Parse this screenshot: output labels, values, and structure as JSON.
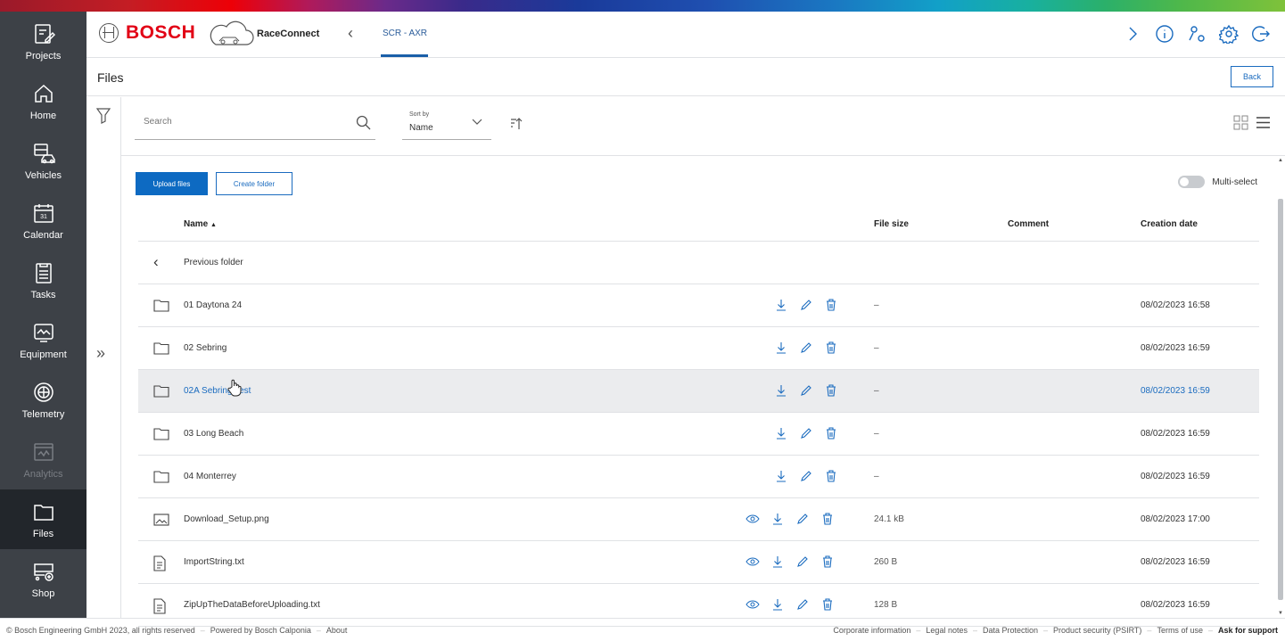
{
  "sidebar": {
    "items": [
      {
        "label": "Projects",
        "icon": "projects-icon"
      },
      {
        "label": "Home",
        "icon": "home-icon"
      },
      {
        "label": "Vehicles",
        "icon": "vehicles-icon"
      },
      {
        "label": "Calendar",
        "icon": "calendar-icon",
        "icon_text": "31"
      },
      {
        "label": "Tasks",
        "icon": "tasks-icon"
      },
      {
        "label": "Equipment",
        "icon": "equipment-icon"
      },
      {
        "label": "Telemetry",
        "icon": "telemetry-icon"
      },
      {
        "label": "Analytics",
        "icon": "analytics-icon",
        "disabled": true
      },
      {
        "label": "Files",
        "icon": "folder-icon",
        "active": true
      },
      {
        "label": "Shop",
        "icon": "shop-icon"
      }
    ]
  },
  "header": {
    "brand": "BOSCH",
    "app_name": "RaceConnect",
    "tab": "SCR - AXR",
    "icons": [
      "chevron-right-icon",
      "info-icon",
      "user-settings-icon",
      "gear-icon",
      "logout-icon"
    ]
  },
  "subheader": {
    "title": "Files",
    "back_label": "Back"
  },
  "toolbar": {
    "search_placeholder": "Search",
    "sort_label": "Sort by",
    "sort_value": "Name"
  },
  "actions": {
    "upload_label": "Upload files",
    "create_folder_label": "Create folder",
    "multiselect_label": "Multi-select",
    "multiselect_on": false
  },
  "table": {
    "headers": {
      "name": "Name",
      "size": "File size",
      "comment": "Comment",
      "date": "Creation date"
    },
    "sort_indicator": "▲",
    "previous_folder": "Previous folder",
    "rows": [
      {
        "type": "folder",
        "name": "01 Daytona 24",
        "size": "–",
        "comment": "",
        "date": "08/02/2023 16:58"
      },
      {
        "type": "folder",
        "name": "02 Sebring",
        "size": "–",
        "comment": "",
        "date": "08/02/2023 16:59"
      },
      {
        "type": "folder",
        "name": "02A Sebring Test",
        "size": "–",
        "comment": "",
        "date": "08/02/2023 16:59",
        "hover": true
      },
      {
        "type": "folder",
        "name": "03 Long Beach",
        "size": "–",
        "comment": "",
        "date": "08/02/2023 16:59"
      },
      {
        "type": "folder",
        "name": "04 Monterrey",
        "size": "–",
        "comment": "",
        "date": "08/02/2023 16:59"
      },
      {
        "type": "image",
        "name": "Download_Setup.png",
        "size": "24.1 kB",
        "comment": "",
        "date": "08/02/2023 17:00"
      },
      {
        "type": "text",
        "name": "ImportString.txt",
        "size": "260 B",
        "comment": "",
        "date": "08/02/2023 16:59"
      },
      {
        "type": "text",
        "name": "ZipUpTheDataBeforeUploading.txt",
        "size": "128 B",
        "comment": "",
        "date": "08/02/2023 16:59"
      }
    ]
  },
  "footer": {
    "left": [
      "© Bosch Engineering GmbH 2023, all rights reserved",
      "Powered by Bosch Calponia",
      "About"
    ],
    "right": [
      "Corporate information",
      "Legal notes",
      "Data Protection",
      "Product security (PSIRT)",
      "Terms of use"
    ],
    "support": "Ask for support"
  },
  "colors": {
    "accent": "#0d6ac2",
    "brand_red": "#e20015",
    "sidebar_bg": "#3d4147"
  }
}
